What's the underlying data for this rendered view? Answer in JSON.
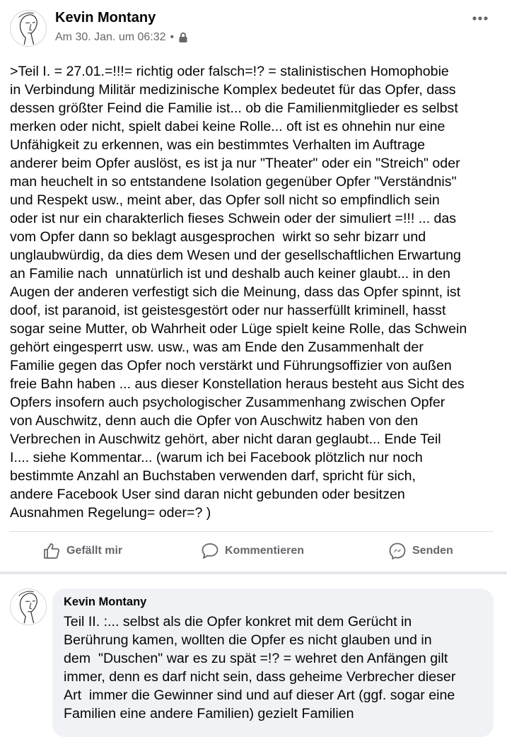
{
  "post": {
    "author": "Kevin Montany",
    "timestamp": "Am 30. Jan. um 06:32",
    "separator": "•",
    "privacy_icon": "lock-icon",
    "more_icon": "more-options-icon",
    "body": ">Teil I. = 27.01.=!!!= richtig oder falsch=!? = stalinistischen Homophobie\nin Verbindung Militär medizinische Komplex bedeutet für das Opfer, dass\ndessen größter Feind die Familie ist... ob die Familienmitglieder es selbst\nmerken oder nicht, spielt dabei keine Rolle... oft ist es ohnehin nur eine\nUnfähigkeit zu erkennen, was ein bestimmtes Verhalten im Auftrage\nanderer beim Opfer auslöst, es ist ja nur \"Theater\" oder ein \"Streich\" oder\nman heuchelt in so entstandene Isolation gegenüber Opfer \"Verständnis\"\nund Respekt usw., meint aber, das Opfer soll nicht so empfindlich sein\noder ist nur ein charakterlich fieses Schwein oder der simuliert =!!! ... das\nvom Opfer dann so beklagt ausgesprochen  wirkt so sehr bizarr und\nunglaubwürdig, da dies dem Wesen und der gesellschaftlichen Erwartung\nan Familie nach  unnatürlich ist und deshalb auch keiner glaubt... in den\nAugen der anderen verfestigt sich die Meinung, dass das Opfer spinnt, ist\ndoof, ist paranoid, ist geistesgestört oder nur hasserfüllt kriminell, hasst\nsogar seine Mutter, ob Wahrheit oder Lüge spielt keine Rolle, das Schwein\ngehört eingesperrt usw. usw., was am Ende den Zusammenhalt der\nFamilie gegen das Opfer noch verstärkt und Führungsoffizier von außen\nfreie Bahn haben ... aus dieser Konstellation heraus besteht aus Sicht des\nOpfers insofern auch psychologischer Zusammenhang zwischen Opfer\nvon Auschwitz, denn auch die Opfer von Auschwitz haben von den\nVerbrechen in Auschwitz gehört, aber nicht daran geglaubt... Ende Teil\nI.... siehe Kommentar... (warum ich bei Facebook plötzlich nur noch\nbestimmte Anzahl an Buchstaben verwenden darf, spricht für sich,\nandere Facebook User sind daran nicht gebunden oder besitzen\nAusnahmen Regelung= oder=? )"
  },
  "actions": {
    "like": {
      "label": "Gefällt mir",
      "icon": "thumbs-up-icon"
    },
    "comment": {
      "label": "Kommentieren",
      "icon": "speech-bubble-icon"
    },
    "send": {
      "label": "Senden",
      "icon": "messenger-icon"
    }
  },
  "comment": {
    "author": "Kevin Montany",
    "body": "Teil II. :... selbst als die Opfer konkret mit dem Gerücht in\nBerührung kamen, wollten die Opfer es nicht glauben und in\ndem  \"Duschen\" war es zu spät =!? = wehret den Anfängen gilt\nimmer, denn es darf nicht sein, dass geheime Verbrecher dieser\nArt  immer die Gewinner sind und auf dieser Art (ggf. sogar eine\nFamilien eine andere Familien) gezielt Familien"
  },
  "colors": {
    "text_primary": "#050505",
    "text_secondary": "#65676b",
    "divider": "#dadde1",
    "comment_bg": "#f0f2f5"
  }
}
